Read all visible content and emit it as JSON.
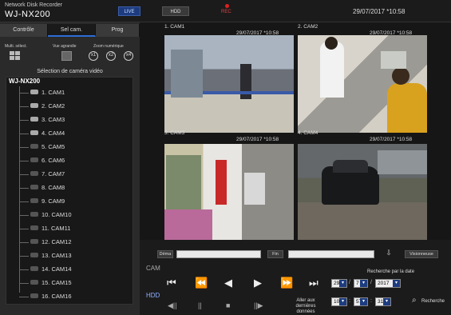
{
  "header": {
    "app_title": "Network Disk Recorder",
    "model": "WJ-NX200",
    "live_label": "LIVE",
    "hdd_label": "HDD",
    "rec_label": "REC",
    "clock": "29/07/2017 *10:58"
  },
  "tabs": [
    "Contrôle",
    "Sel cam.",
    "Prog"
  ],
  "tools": {
    "multi_label": "Multi. sélect.",
    "vue_label": "Vue agrandie",
    "zoom_label": "Zoom numérique",
    "zoom_buttons": [
      "x1",
      "x2",
      "x4"
    ]
  },
  "selection_title": "Sélection de caméra vidéo",
  "tree_root": "WJ-NX200",
  "cameras": [
    "1. CAM1",
    "2. CAM2",
    "3. CAM3",
    "4. CAM4",
    "5. CAM5",
    "6. CAM6",
    "7. CAM7",
    "8. CAM8",
    "9. CAM9",
    "10. CAM10",
    "11. CAM11",
    "12. CAM12",
    "13. CAM13",
    "14. CAM14",
    "15. CAM15",
    "16. CAM16"
  ],
  "viewer": {
    "tiles": [
      {
        "label": "1. CAM1",
        "time": "29/07/2017 *10:58"
      },
      {
        "label": "2. CAM2",
        "time": "29/07/2017 *10:58"
      },
      {
        "label": "3. CAM3",
        "time": "29/07/2017 *10:58"
      },
      {
        "label": "4. CAM4",
        "time": "29/07/2017 *10:58"
      }
    ]
  },
  "bottom": {
    "start_label": "Déma",
    "end_label": "Fin",
    "viewer_label": "Visionneuse",
    "side_cam": "CAM",
    "side_hdd": "HDD",
    "search_by_date": "Recherche par la date",
    "goto_label": "Aller aux dernières données",
    "search_label": "Recherche",
    "date": {
      "day": "29",
      "month": "7",
      "year": "2017"
    },
    "time": {
      "hour": "10",
      "minute": "57",
      "second": "31"
    },
    "date_sep": "/",
    "time_sep": ":"
  },
  "colors": {
    "accent": "#1d3c80",
    "rec": "#e02020",
    "tab_active_border": "#2d6dd6"
  }
}
